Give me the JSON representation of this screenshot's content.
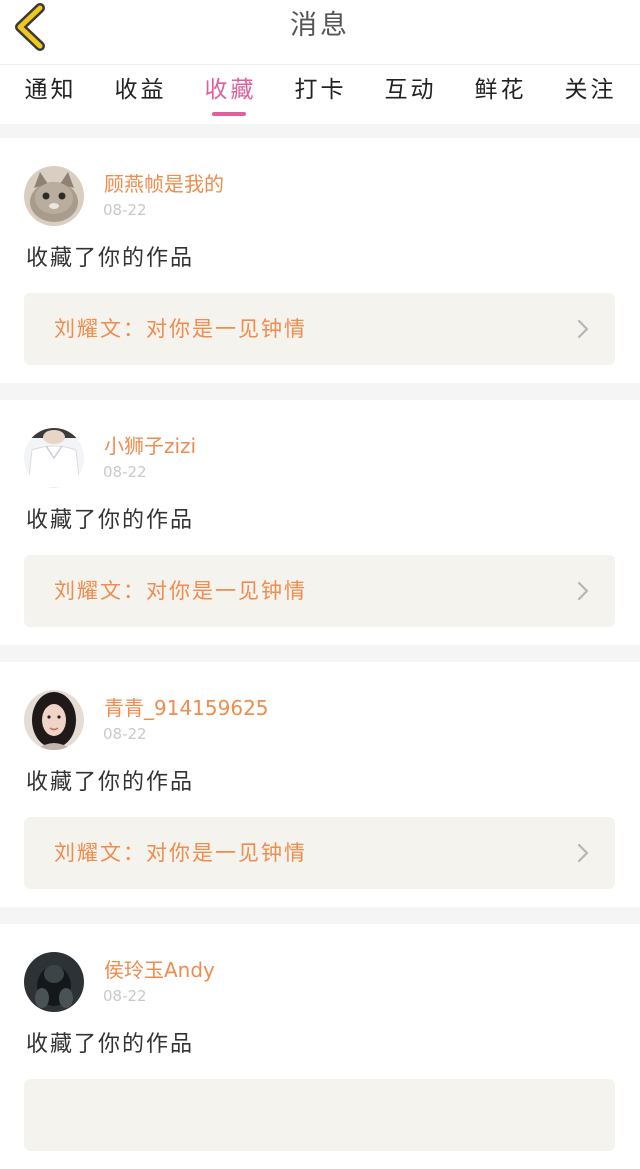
{
  "header": {
    "title": "消息",
    "back_icon": "chevron-left-icon"
  },
  "tabs": [
    {
      "label": "通知",
      "active": false
    },
    {
      "label": "收益",
      "active": false
    },
    {
      "label": "收藏",
      "active": true
    },
    {
      "label": "打卡",
      "active": false
    },
    {
      "label": "互动",
      "active": false
    },
    {
      "label": "鲜花",
      "active": false
    },
    {
      "label": "关注",
      "active": false
    }
  ],
  "items": [
    {
      "username": "顾燕帧是我的",
      "date": "08-22",
      "action": "收藏了你的作品",
      "work_title": "刘耀文：对你是一见钟情"
    },
    {
      "username": "小狮子zizi",
      "date": "08-22",
      "action": "收藏了你的作品",
      "work_title": "刘耀文：对你是一见钟情"
    },
    {
      "username": "青青_914159625",
      "date": "08-22",
      "action": "收藏了你的作品",
      "work_title": "刘耀文：对你是一见钟情"
    },
    {
      "username": "侯玲玉Andy",
      "date": "08-22",
      "action": "收藏了你的作品",
      "work_title": ""
    }
  ],
  "colors": {
    "accent": "#e0609a",
    "username": "#ef8c4e",
    "back_icon": "#f2c81e"
  }
}
